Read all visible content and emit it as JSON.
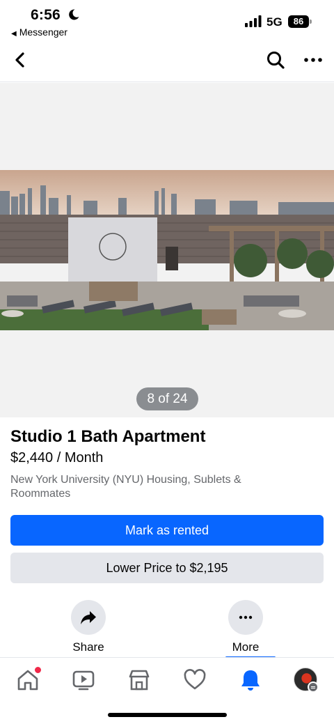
{
  "status_bar": {
    "time": "6:56",
    "back_app": "Messenger",
    "network": "5G",
    "battery": "86"
  },
  "listing": {
    "photo_counter": "8 of 24",
    "title": "Studio 1 Bath Apartment",
    "price": "$2,440 / Month",
    "group": "New York University (NYU) Housing, Sublets & Roommates"
  },
  "buttons": {
    "primary": "Mark as rented",
    "secondary": "Lower Price to $2,195"
  },
  "actions": {
    "share": "Share",
    "more": "More"
  },
  "colors": {
    "accent": "#0866ff",
    "secondary_bg": "#e4e6eb",
    "muted_text": "#65676b",
    "notification_dot": "#f02849"
  },
  "icons": [
    "back-icon",
    "search-icon",
    "more-icon",
    "share-icon",
    "more-dots-icon",
    "home-icon",
    "video-icon",
    "marketplace-icon",
    "dating-icon",
    "bell-icon",
    "avatar"
  ]
}
